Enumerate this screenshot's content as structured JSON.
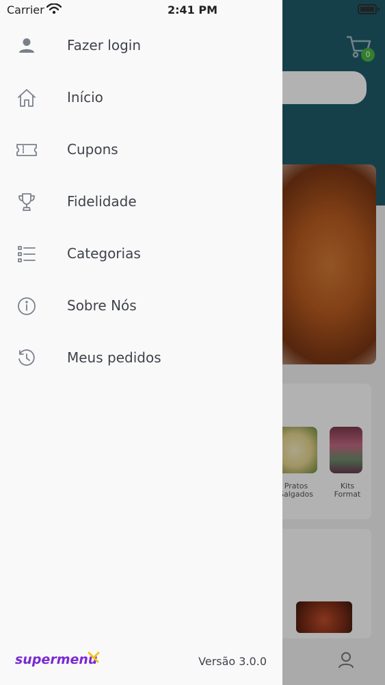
{
  "status_bar": {
    "carrier": "Carrier",
    "time": "2:41 PM"
  },
  "drawer": {
    "items": [
      {
        "label": "Fazer login",
        "icon": "user-icon"
      },
      {
        "label": "Início",
        "icon": "home-icon"
      },
      {
        "label": "Cupons",
        "icon": "ticket-icon"
      },
      {
        "label": "Fidelidade",
        "icon": "trophy-icon"
      },
      {
        "label": "Categorias",
        "icon": "list-icon"
      },
      {
        "label": "Sobre Nós",
        "icon": "info-icon"
      },
      {
        "label": "Meus pedidos",
        "icon": "history-icon"
      }
    ],
    "logo_text": "supermenu",
    "version": "Versão 3.0.0"
  },
  "background": {
    "cart_count": "0",
    "category_labels": [
      "Pratos\nSalgados",
      "Kits\nFormat"
    ]
  },
  "colors": {
    "brand_purple": "#7a2ad1",
    "brand_yellow": "#f5c518",
    "header_teal": "#1f5c6b",
    "badge_green": "#4bb543",
    "icon_gray": "#7a808a",
    "label_text": "#3f4349"
  }
}
